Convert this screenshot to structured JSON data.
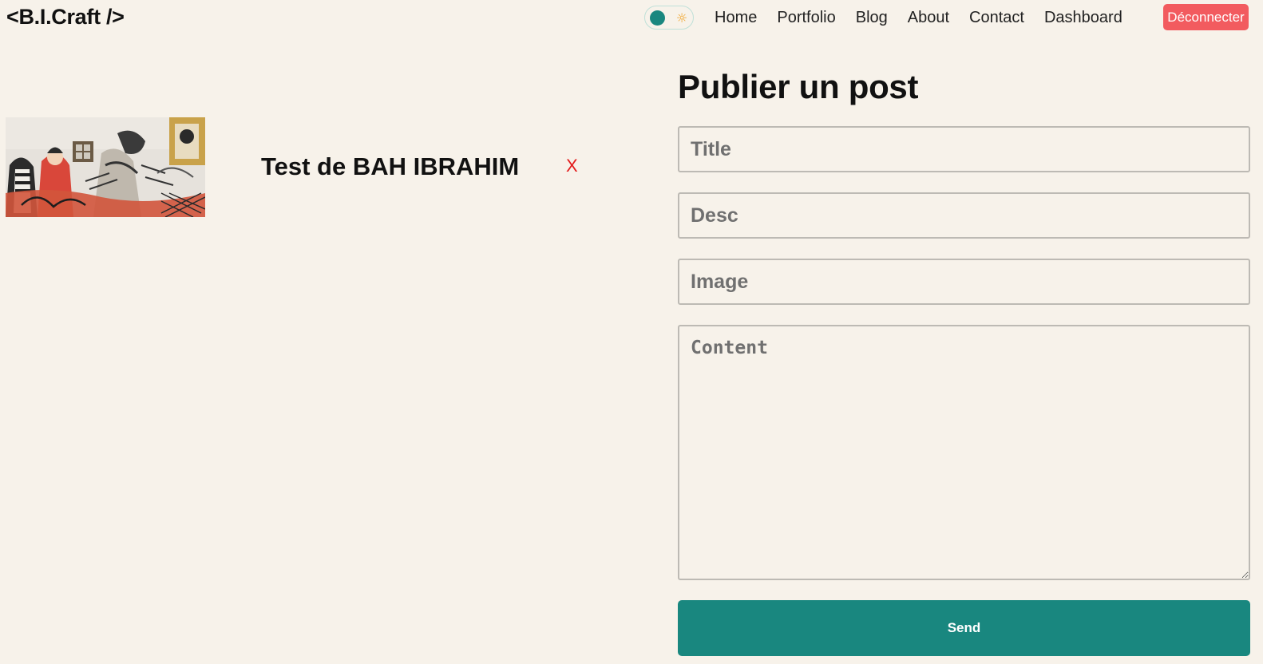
{
  "header": {
    "logo": "<B.I.Craft />",
    "theme_toggle": {
      "state": "dark-knob-left",
      "sun_icon": "sun-icon"
    },
    "nav": [
      "Home",
      "Portfolio",
      "Blog",
      "About",
      "Contact",
      "Dashboard"
    ],
    "logout_label": "Déconnecter"
  },
  "posts": [
    {
      "title": "Test de BAH IBRAHIM",
      "delete_label": "X",
      "thumbnail": "graffiti-mural-image"
    }
  ],
  "form": {
    "heading": "Publier un post",
    "title_placeholder": "Title",
    "desc_placeholder": "Desc",
    "image_placeholder": "Image",
    "content_placeholder": "Content",
    "submit_label": "Send"
  },
  "colors": {
    "background": "#f7f2ea",
    "accent": "#19877f",
    "danger": "#f25b5f",
    "delete_x": "#e31b1b"
  }
}
